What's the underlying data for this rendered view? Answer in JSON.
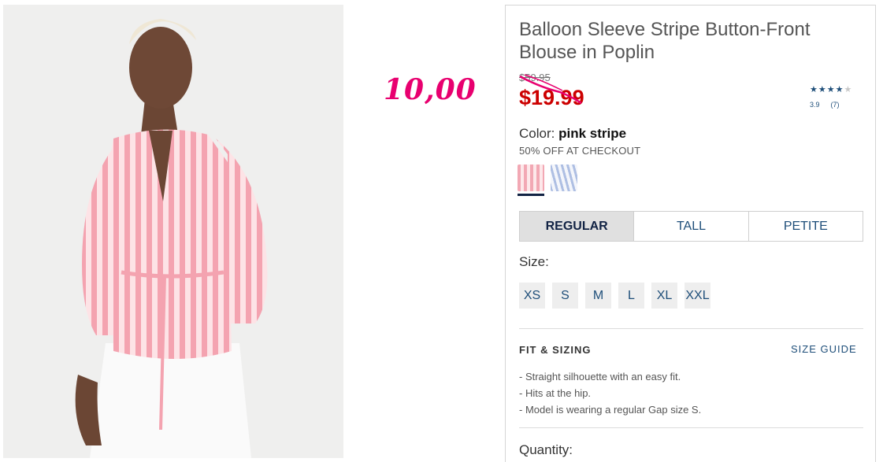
{
  "annotation": {
    "handwritten_price": "10,00"
  },
  "product": {
    "title": "Balloon Sleeve Stripe Button-Front Blouse in Poplin",
    "original_price": "$59.95",
    "sale_price": "$19.99",
    "rating": {
      "value": 3.9,
      "display": "3.9",
      "count": "(7)",
      "stars_filled": 4,
      "stars_total": 5
    },
    "color_label": "Color:",
    "color_value": "pink stripe",
    "promo": "50% OFF AT CHECKOUT",
    "swatches": [
      {
        "name": "pink stripe",
        "selected": true
      },
      {
        "name": "blue stripe",
        "selected": false
      }
    ],
    "fit_tabs": [
      {
        "label": "REGULAR",
        "active": true
      },
      {
        "label": "TALL",
        "active": false
      },
      {
        "label": "PETITE",
        "active": false
      }
    ],
    "size_label": "Size:",
    "sizes": [
      "XS",
      "S",
      "M",
      "L",
      "XL",
      "XXL"
    ],
    "fit_heading": "FIT & SIZING",
    "size_guide": "SIZE GUIDE",
    "fit_points": [
      "- Straight silhouette with an easy fit.",
      "- Hits at the hip.",
      "- Model is wearing a regular Gap size S."
    ],
    "quantity_label": "Quantity:"
  },
  "colors": {
    "sale_red": "#cc0000",
    "brand_navy": "#122344",
    "link_blue": "#1e4e79",
    "annotation_pink": "#e8006f"
  }
}
